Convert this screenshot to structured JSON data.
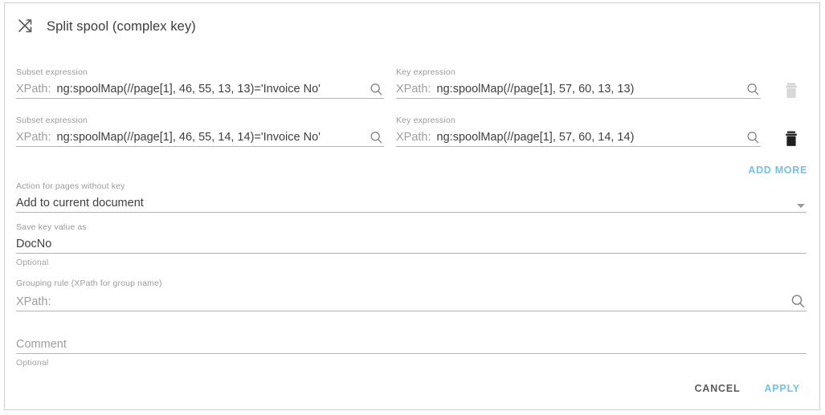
{
  "dialog": {
    "title": "Split spool (complex key)",
    "title_icon": "shuffle-icon"
  },
  "rules": [
    {
      "subset": {
        "label": "Subset expression",
        "prefix": "XPath:",
        "value": "ng:spoolMap(//page[1], 46, 55, 13, 13)='Invoice No'",
        "search_icon": "search-icon"
      },
      "key": {
        "label": "Key expression",
        "prefix": "XPath:",
        "value": "ng:spoolMap(//page[1], 57, 60, 13, 13)",
        "search_icon": "search-icon"
      },
      "delete": {
        "icon": "trash-icon",
        "enabled": false,
        "color": "#cfcfcf"
      }
    },
    {
      "subset": {
        "label": "Subset expression",
        "prefix": "XPath:",
        "value": "ng:spoolMap(//page[1], 46, 55, 14, 14)='Invoice No'",
        "search_icon": "search-icon"
      },
      "key": {
        "label": "Key expression",
        "prefix": "XPath:",
        "value": "ng:spoolMap(//page[1], 57, 60, 14, 14)",
        "search_icon": "search-icon"
      },
      "delete": {
        "icon": "trash-icon",
        "enabled": true,
        "color": "#1f1f1f"
      }
    }
  ],
  "add_more_label": "ADD MORE",
  "action_field": {
    "label": "Action for pages without key",
    "value": "Add to current document",
    "caret_icon": "chevron-down-icon"
  },
  "save_key_field": {
    "label": "Save key value as",
    "value": "DocNo",
    "hint": "Optional"
  },
  "grouping_field": {
    "label": "Grouping rule (XPath for group name)",
    "prefix": "XPath:",
    "value": "",
    "search_icon": "search-icon"
  },
  "comment_field": {
    "placeholder": "Comment",
    "value": "",
    "hint": "Optional"
  },
  "footer": {
    "cancel_label": "CANCEL",
    "apply_label": "APPLY"
  },
  "colors": {
    "accent": "#6fc1ea",
    "text": "#3f3f3f",
    "muted": "#9a9a9a",
    "underline": "#b5b5b5",
    "border": "#cfcfcf"
  }
}
